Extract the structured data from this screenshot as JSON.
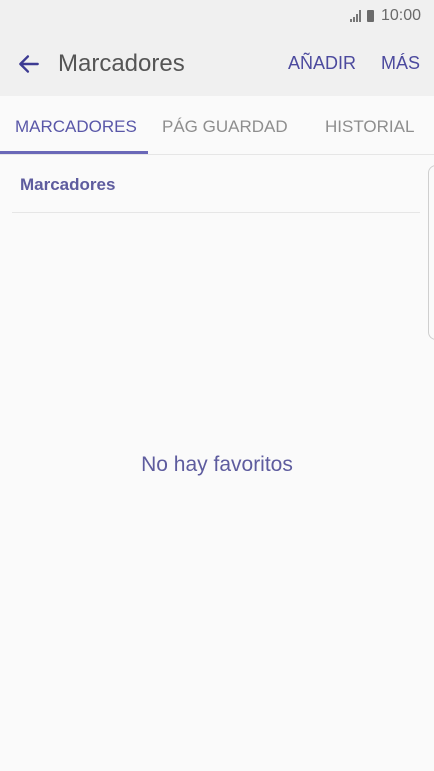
{
  "status_bar": {
    "time": "10:00",
    "signal_icon": "signal-icon",
    "battery_icon": "battery-icon"
  },
  "app_bar": {
    "back_icon": "arrow-left-icon",
    "title": "Marcadores",
    "actions": [
      "AÑADIR",
      "MÁS"
    ]
  },
  "tabs": [
    {
      "label": "MARCADORES",
      "active": true
    },
    {
      "label": "PÁG GUARDAD",
      "active": false
    },
    {
      "label": "HISTORIAL",
      "active": false
    }
  ],
  "content": {
    "section_header": "Marcadores",
    "empty_message": "No hay favoritos"
  },
  "colors": {
    "accent": "#5957a8",
    "background": "#fafafa",
    "header_bg": "#f0f0f0"
  }
}
